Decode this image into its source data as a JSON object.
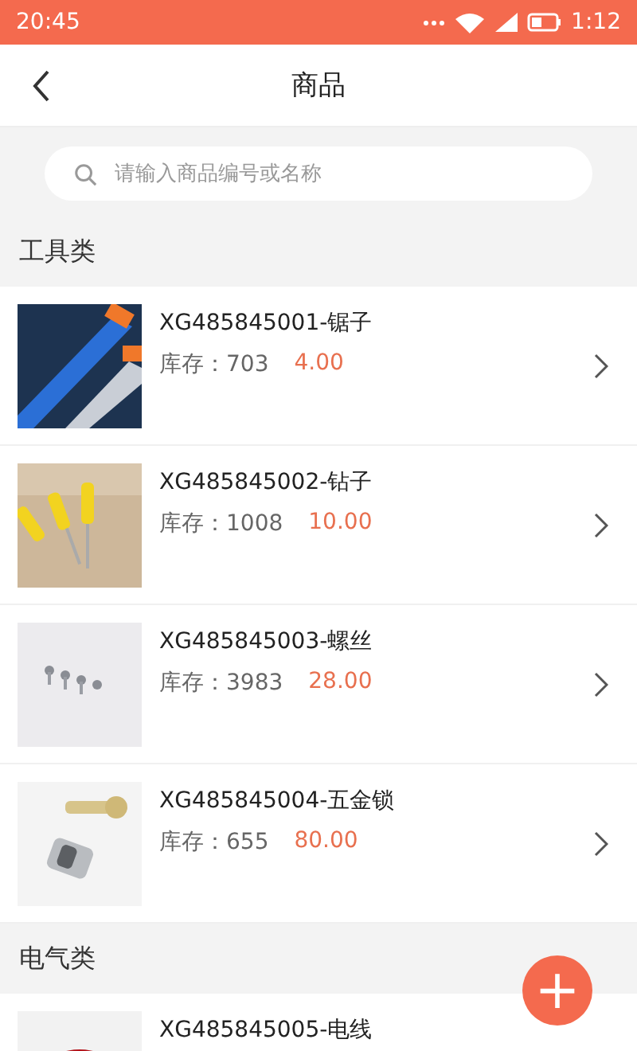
{
  "status_bar": {
    "time": "20:45",
    "clock_right": "1:12"
  },
  "header": {
    "title": "商品"
  },
  "search": {
    "placeholder": "请输入商品编号或名称"
  },
  "categories": [
    {
      "name": "工具类",
      "items": [
        {
          "name": "XG485845001-锯子",
          "stock_label": "库存：",
          "stock": "703",
          "price": "4.00"
        },
        {
          "name": "XG485845002-钻子",
          "stock_label": "库存：",
          "stock": "1008",
          "price": "10.00"
        },
        {
          "name": "XG485845003-螺丝",
          "stock_label": "库存：",
          "stock": "3983",
          "price": "28.00"
        },
        {
          "name": "XG485845004-五金锁",
          "stock_label": "库存：",
          "stock": "655",
          "price": "80.00"
        }
      ]
    },
    {
      "name": "电气类",
      "items": [
        {
          "name": "XG485845005-电线"
        }
      ]
    }
  ],
  "fab": {
    "label": "+"
  }
}
